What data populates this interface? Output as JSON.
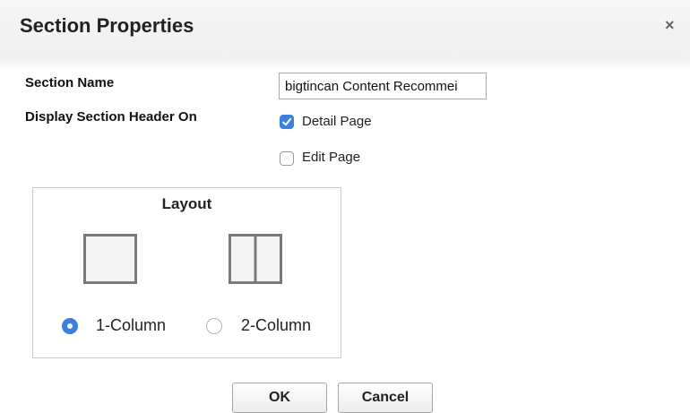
{
  "dialog": {
    "title": "Section Properties",
    "close_glyph": "×",
    "close_icon": "close-icon"
  },
  "section_name": {
    "label": "Section Name",
    "value": "bigtincan Content Recommei"
  },
  "display_header": {
    "label": "Display Section Header On",
    "options": [
      {
        "label": "Detail Page",
        "checked": true
      },
      {
        "label": "Edit Page",
        "checked": false
      }
    ]
  },
  "layout": {
    "title": "Layout",
    "options": [
      {
        "label": "1-Column",
        "selected": true,
        "icon": "one-column-layout-icon"
      },
      {
        "label": "2-Column",
        "selected": false,
        "icon": "two-column-layout-icon"
      }
    ]
  },
  "buttons": {
    "ok": "OK",
    "cancel": "Cancel"
  },
  "colors": {
    "accent": "#3b7fe0",
    "header_bg": "#f2f2f2",
    "border": "#c9c9c9"
  }
}
